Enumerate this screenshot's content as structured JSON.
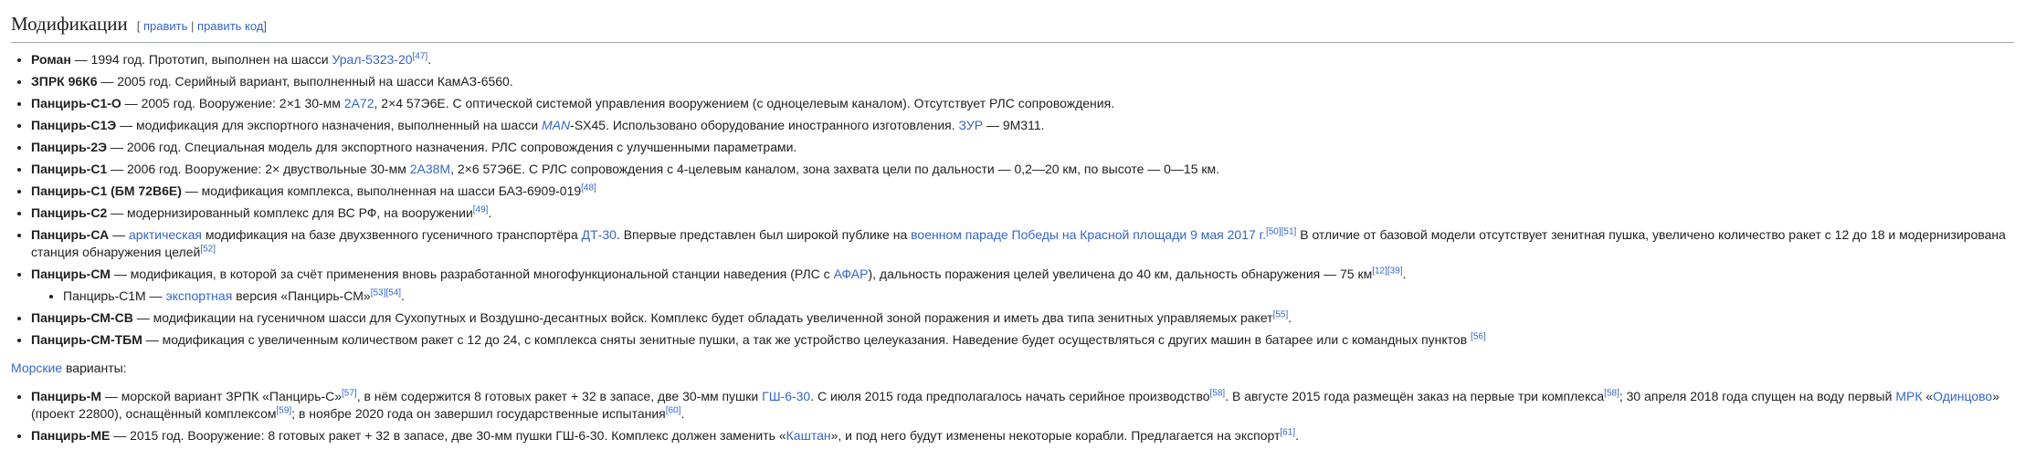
{
  "heading": {
    "title": "Модификации",
    "edit_open": "[",
    "edit_link": "править",
    "sep": "|",
    "edit_code": "править код",
    "edit_close": "]"
  },
  "items": [
    {
      "b": "Роман",
      "t1": " — 1994 год. Прототип, выполнен на шасси ",
      "l1": "Урал-5323-20",
      "s1": "[47]",
      "t2": "."
    },
    {
      "b": "ЗПРК 96К6",
      "t1": " — 2005 год. Серийный вариант, выполненный на шасси КамАЗ-6560."
    },
    {
      "b": "Панцирь-С1-О",
      "t1": " — 2005 год. Вооружение: 2×1 30-мм ",
      "l1": "2А72",
      "t2": ", 2×4 57Э6Е. С оптической системой управления вооружением (с одноцелевым каналом). Отсутствует РЛС сопровождения."
    },
    {
      "b": "Панцирь-С1Э",
      "t1": " — модификация для экспортного назначения, выполненный на шасси ",
      "l1": "MAN",
      "t2": "-SX45. Использовано оборудование иностранного изготовления. ",
      "l2": "ЗУР",
      "t3": " — 9М311."
    },
    {
      "b": "Панцирь-2Э",
      "t1": " — 2006 год. Специальная модель для экспортного назначения. РЛС сопровождения с улучшенными параметрами."
    },
    {
      "b": "Панцирь-С1",
      "t1": " — 2006 год. Вооружение: 2× двуствольные 30-мм ",
      "l1": "2А38М",
      "t2": ", 2×6 57Э6Е. С РЛС сопровождения с 4-целевым каналом, зона захвата цели по дальности — 0,2—20 км, по высоте — 0—15 км."
    },
    {
      "b": "Панцирь-С1 (БМ 72В6Е)",
      "t1": " — модификация комплекса, выполненная на шасси БАЗ-6909-019",
      "s1": "[48]"
    },
    {
      "b": "Панцирь-С2",
      "t1": " — модернизированный комплекс для ВС РФ, на вооружении",
      "s1": "[49]",
      "t2": "."
    },
    {
      "b": "Панцирь-СА",
      "t1": " — ",
      "l1": "арктическая",
      "t2": " модификация на базе двухзвенного гусеничного транспортёра ",
      "l2": "ДТ-30",
      "t3": ". Впервые представлен был широкой публике на ",
      "l3": "военном параде Победы на Красной площади 9 мая 2017 г.",
      "s1": "[50][51]",
      "t4": " В отличие от базовой модели отсутствует зенитная пушка, увеличено количество ракет с 12 до 18 и модернизирована станция обнаружения целей",
      "s2": "[52]"
    },
    {
      "b": "Панцирь-СМ",
      "t1": " — модификация, в которой за счёт применения вновь разработанной многофункциональной станции наведения (РЛС с ",
      "l1": "АФАР",
      "t2": "), дальность поражения целей увеличена до 40 км, дальность обнаружения — 75 км",
      "s1": "[12][39]",
      "t3": "."
    }
  ],
  "subitem": {
    "t1": "Панцирь-С1М — ",
    "l1": "экспортная",
    "t2": " версия «Панцирь-СМ»",
    "s1": "[53][54]",
    "t3": "."
  },
  "items2": [
    {
      "b": "Панцирь-СМ-СВ",
      "t1": " — модификации на гусеничном шасси для Сухопутных и Воздушно-десантных войск. Комплекс будет обладать увеличенной зоной поражения и иметь два типа зенитных управляемых ракет",
      "s1": "[55]",
      "t2": "."
    },
    {
      "b": "Панцирь-СМ-ТБМ",
      "t1": " — модификация с увеличенным количеством ракет с 12 до 24, с комплекса сняты зенитные пушки, а так же устройство целеуказания. Наведение будет осуществляться с других машин в батарее или с командных пунктов ",
      "s1": "[56]"
    }
  ],
  "naval_intro": {
    "link": "Морские",
    "text": " варианты:"
  },
  "naval": [
    {
      "b": "Панцирь-М",
      "t1": " — морской вариант ЗРПК «Панцирь-С»",
      "s1": "[57]",
      "t2": ", в нём содержится 8 готовых ракет + 32 в запасе, две 30-мм пушки ",
      "l1": "ГШ-6-30",
      "t3": ". С июля 2015 года предполагалось начать серийное производство",
      "s2": "[58]",
      "t4": ". В августе 2015 года размещён заказ на первые три комплекса",
      "s3": "[58]",
      "t5": "; 30 апреля 2018 года спущен на воду первый ",
      "l2": "МРК",
      "t6": " «",
      "l3": "Одинцово",
      "t7": "» (проект 22800), оснащённый комплексом",
      "s4": "[59]",
      "t8": "; в ноябре 2020 года он завершил государственные испытания",
      "s5": "[60]",
      "t9": "."
    },
    {
      "b": "Панцирь-МЕ",
      "t1": " — 2015 год. Вооружение: 8 готовых ракет + 32 в запасе, две 30-мм пушки ГШ-6-30. Комплекс должен заменить «",
      "l1": "Каштан",
      "t2": "», и под него будут изменены некоторые корабли. Предлагается на экспорт",
      "s1": "[61]",
      "t3": "."
    }
  ]
}
